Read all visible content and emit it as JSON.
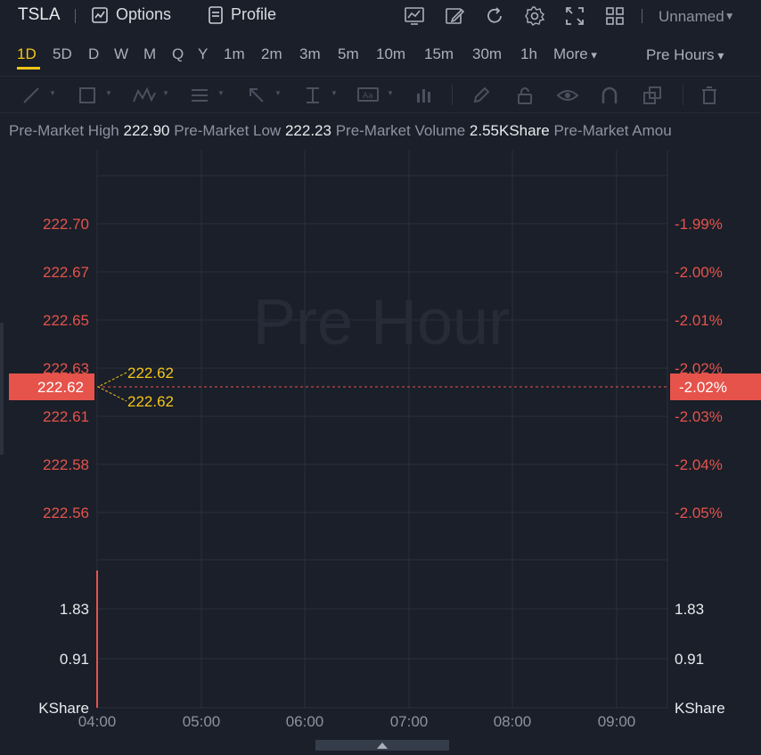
{
  "header": {
    "ticker": "TSLA",
    "options_label": "Options",
    "profile_label": "Profile",
    "layout_name": "Unnamed"
  },
  "periods": {
    "items": [
      "1D",
      "5D",
      "D",
      "W",
      "M",
      "Q",
      "Y",
      "1m",
      "2m",
      "3m",
      "5m",
      "10m",
      "15m",
      "30m",
      "1h",
      "More"
    ],
    "active": "1D",
    "session": "Pre Hours"
  },
  "stats": {
    "high_label": "Pre-Market High",
    "high_value": "222.90",
    "low_label": "Pre-Market Low",
    "low_value": "222.23",
    "volume_label": "Pre-Market Volume",
    "volume_value": "2.55KShare",
    "amount_label": "Pre-Market Amou"
  },
  "chart_data": {
    "type": "line",
    "watermark": "Pre Hour",
    "price_ticks": [
      "222.70",
      "222.67",
      "222.65",
      "222.63",
      "222.61",
      "222.58",
      "222.56"
    ],
    "pct_ticks": [
      "-1.99%",
      "-2.00%",
      "-2.01%",
      "-2.02%",
      "-2.03%",
      "-2.04%",
      "-2.05%"
    ],
    "current_price": "222.62",
    "current_pct": "-2.02%",
    "annotation_high": "222.62",
    "annotation_low": "222.62",
    "volume_ticks": [
      "1.83",
      "0.91"
    ],
    "volume_unit": "KShare",
    "x_ticks": [
      "04:00",
      "05:00",
      "06:00",
      "07:00",
      "08:00",
      "09:00"
    ],
    "colors": {
      "price_text": "#e5534b",
      "price_badge": "#e5534b",
      "annotation": "#f5c518",
      "grid": "#2b313c",
      "volume_text": "#e8ebef"
    }
  }
}
